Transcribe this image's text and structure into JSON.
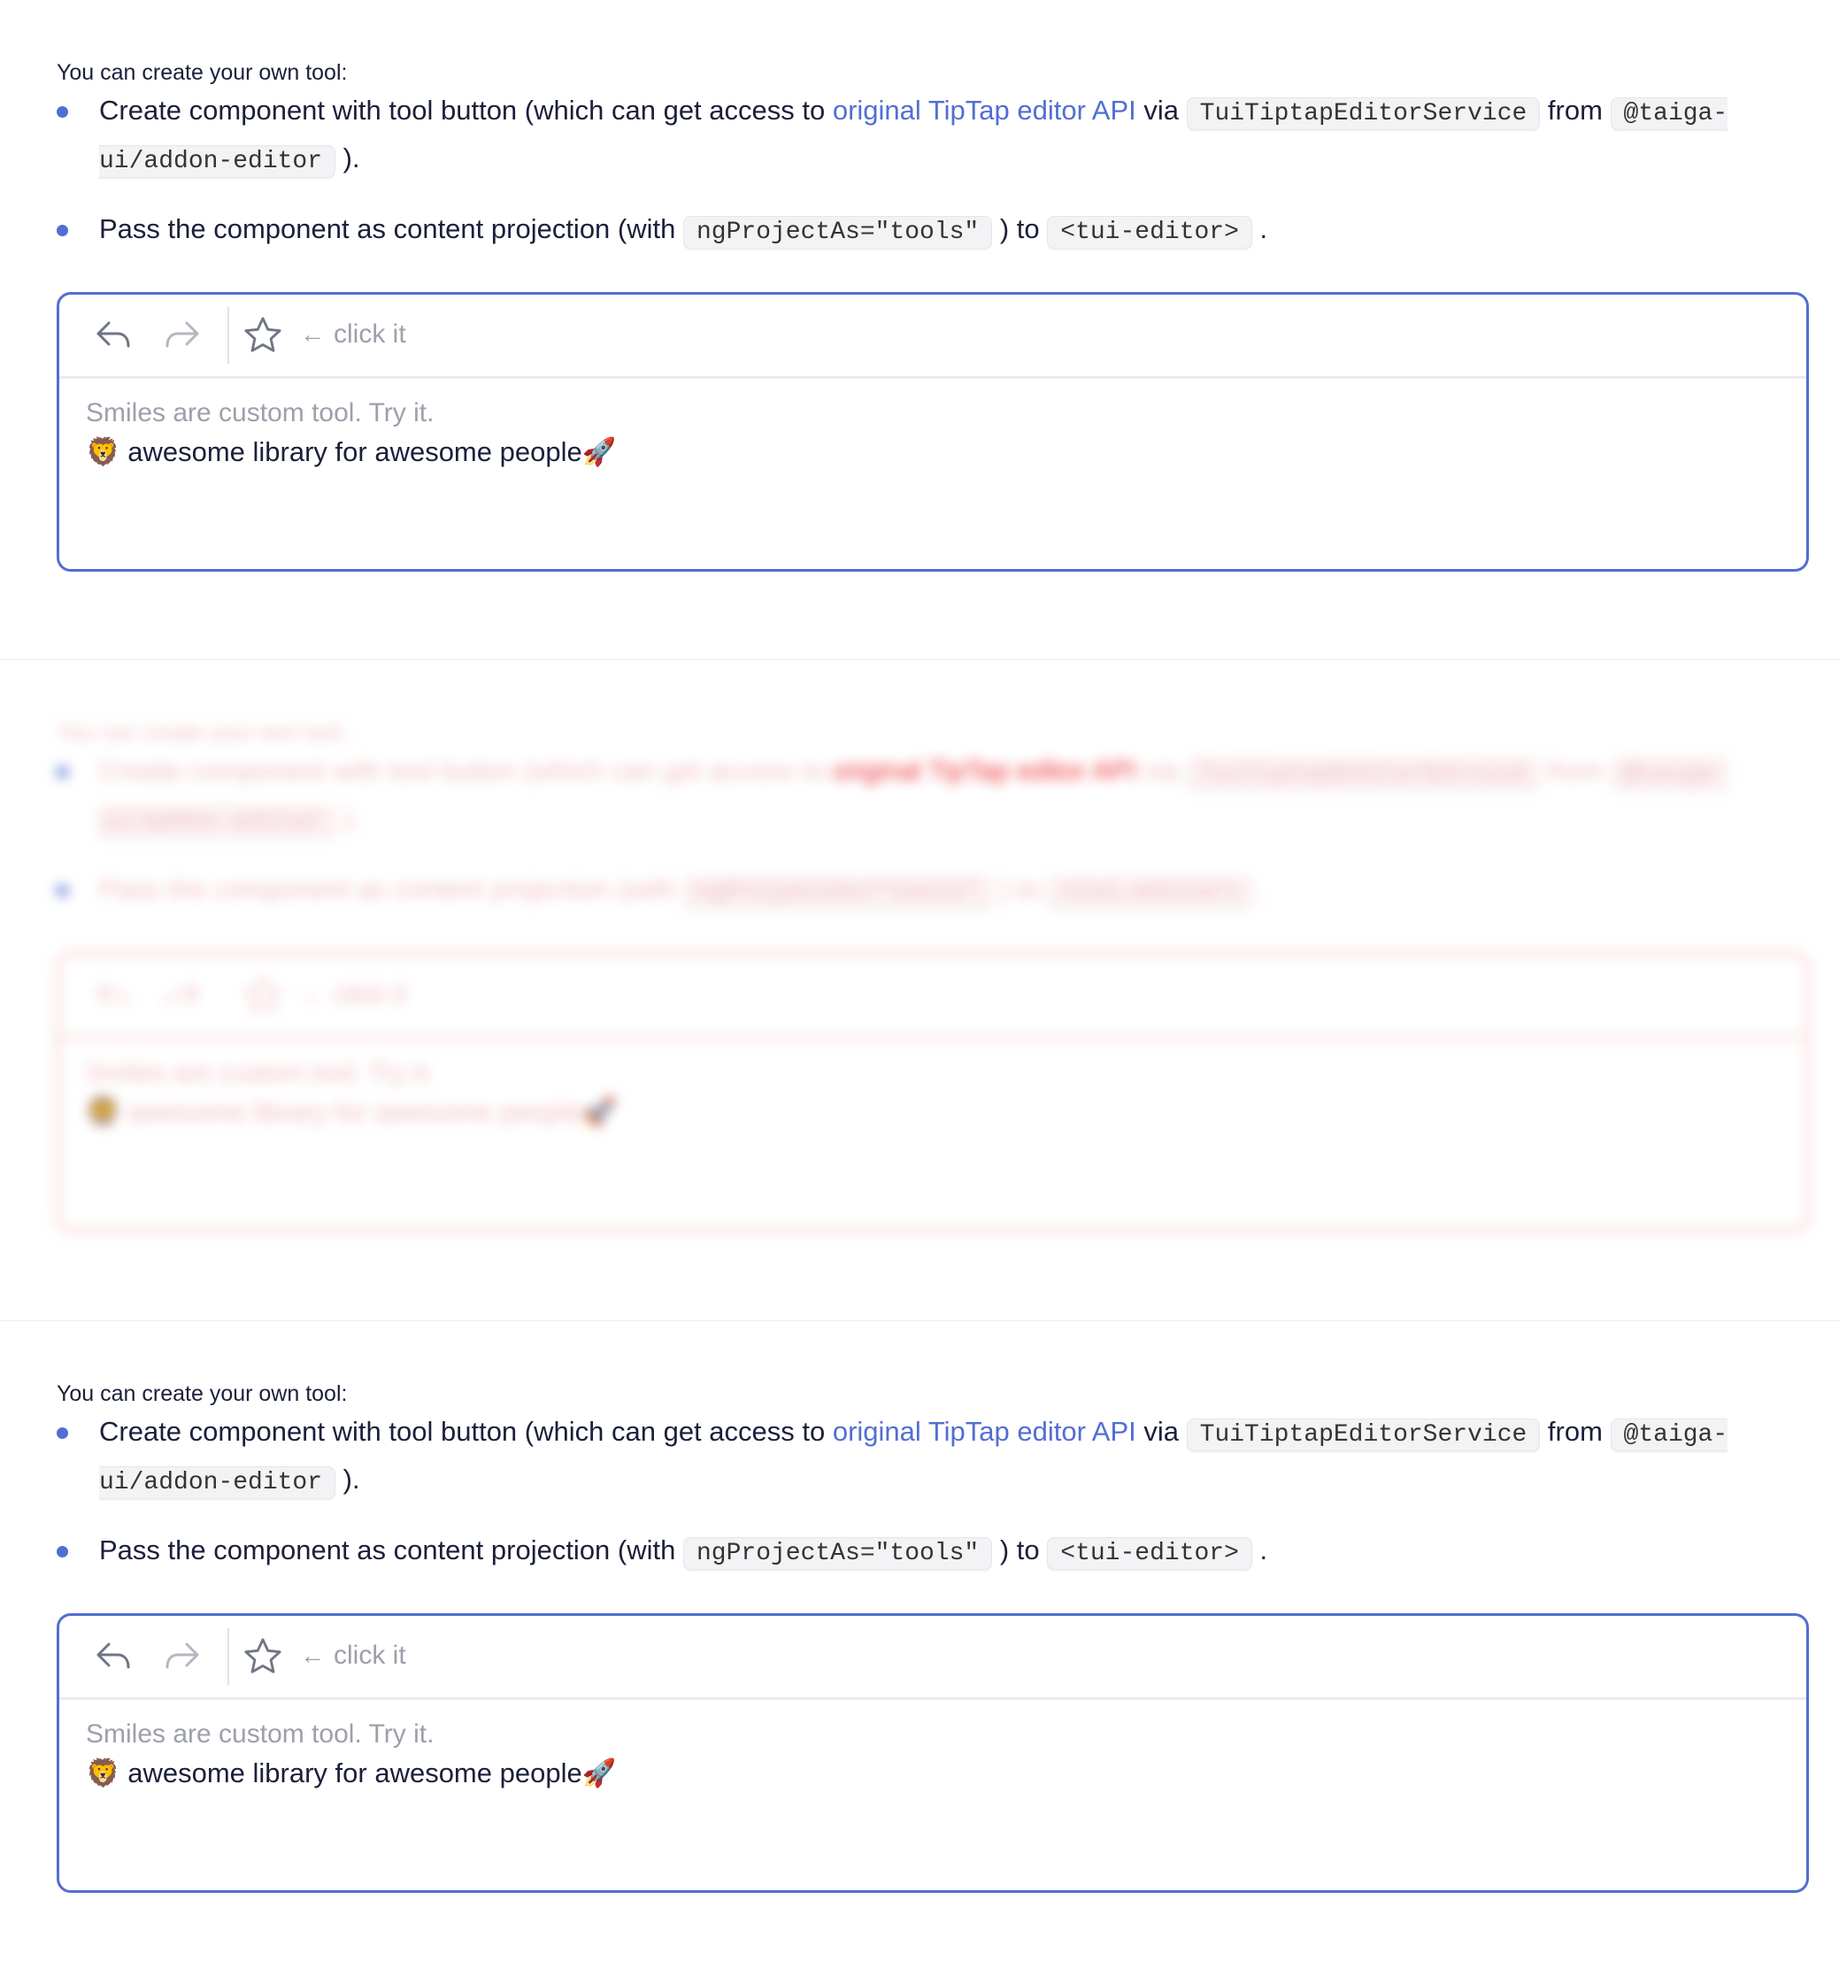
{
  "intro": "You can create your own tool:",
  "steps": {
    "one": {
      "text_a": "Create component with tool button (which can get access to ",
      "link": "original TipTap editor API",
      "text_b": " via ",
      "code_a": "TuiTiptapEditorService",
      "text_c": " from ",
      "code_b": "@taiga-ui/addon-editor",
      "text_d": " )."
    },
    "two": {
      "text_a": "Pass the component as content projection (with ",
      "code_a": "ngProjectAs=\"tools\"",
      "text_b": " ) to ",
      "code_b": "<tui-editor>",
      "text_c": " ."
    }
  },
  "editor": {
    "tools": [
      "undo-icon",
      "redo-icon",
      "star-icon"
    ],
    "hint": "click it",
    "hint_arrow": "←",
    "placeholder": "Smiles are custom tool. Try it.",
    "lion": "🦁",
    "content": "awesome library for awesome people",
    "rocket": "🚀"
  },
  "colors": {
    "accent": "#526ed3",
    "blur_tint": "#e8181e"
  }
}
